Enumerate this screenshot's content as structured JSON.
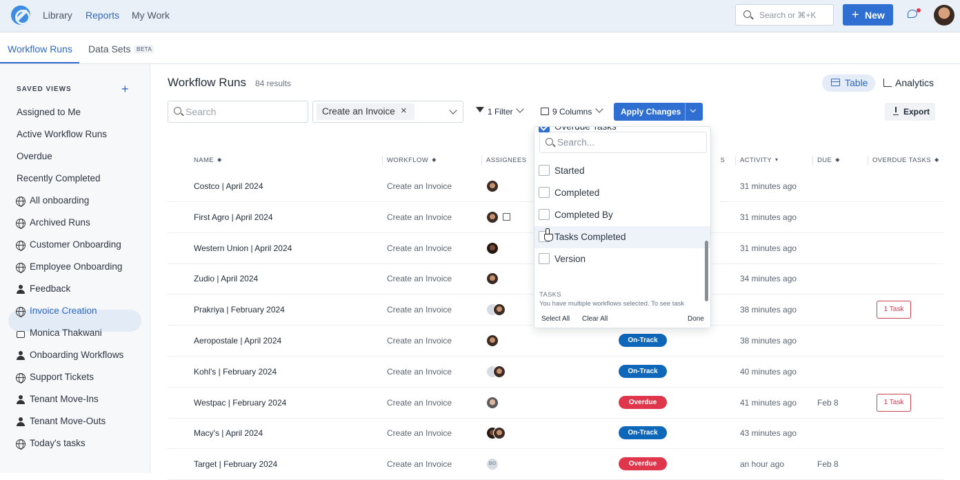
{
  "topnav": {
    "library": "Library",
    "reports": "Reports",
    "mywork": "My Work",
    "search_placeholder": "Search or ⌘+K",
    "new_label": "New"
  },
  "subtabs": {
    "workflow_runs": "Workflow Runs",
    "data_sets": "Data Sets",
    "beta": "BETA"
  },
  "sidebar": {
    "title": "SAVED VIEWS",
    "items": [
      {
        "label": "Assigned to Me",
        "icon": ""
      },
      {
        "label": "Active Workflow Runs",
        "icon": ""
      },
      {
        "label": "Overdue",
        "icon": ""
      },
      {
        "label": "Recently Completed",
        "icon": ""
      },
      {
        "label": "All onboarding",
        "icon": "globe-icon"
      },
      {
        "label": "Archived Runs",
        "icon": "globe-icon"
      },
      {
        "label": "Customer Onboarding",
        "icon": "globe-icon"
      },
      {
        "label": "Employee Onboarding",
        "icon": "globe-icon"
      },
      {
        "label": "Feedback",
        "icon": "people-icon"
      },
      {
        "label": "Invoice Creation",
        "icon": "globe-icon",
        "selected": true
      },
      {
        "label": "Monica Thakwani",
        "icon": "lock-icon"
      },
      {
        "label": "Onboarding Workflows",
        "icon": "people-icon"
      },
      {
        "label": "Support Tickets",
        "icon": "globe-icon"
      },
      {
        "label": "Tenant Move-Ins",
        "icon": "people-icon"
      },
      {
        "label": "Tenant Move-Outs",
        "icon": "people-icon"
      },
      {
        "label": "Today's tasks",
        "icon": "globe-icon"
      }
    ]
  },
  "main": {
    "title": "Workflow Runs",
    "results": "84 results",
    "view_table": "Table",
    "view_analytics": "Analytics",
    "search_placeholder": "Search",
    "workflow_chip": "Create an Invoice",
    "filter_label": "1 Filter",
    "columns_label": "9 Columns",
    "apply_label": "Apply Changes",
    "export_label": "Export"
  },
  "table": {
    "headers": {
      "name": "NAME",
      "workflow": "WORKFLOW",
      "assignees": "ASSIGNEES",
      "comments": "NTS",
      "activity": "ACTIVITY",
      "due": "DUE",
      "overdue_tasks": "OVERDUE TASKS"
    },
    "rows": [
      {
        "name": "Costco | April 2024",
        "workflow": "Create an Invoice",
        "status": "",
        "activity": "31 minutes ago",
        "due": "",
        "overdue": ""
      },
      {
        "name": "First Agro | April 2024",
        "workflow": "Create an Invoice",
        "status": "",
        "activity": "31 minutes ago",
        "due": "",
        "overdue": ""
      },
      {
        "name": "Western Union | April 2024",
        "workflow": "Create an Invoice",
        "status": "",
        "activity": "31 minutes ago",
        "due": "",
        "overdue": ""
      },
      {
        "name": "Zudio | April 2024",
        "workflow": "Create an Invoice",
        "status": "",
        "activity": "34 minutes ago",
        "due": "",
        "overdue": ""
      },
      {
        "name": "Prakriya | February 2024",
        "workflow": "Create an Invoice",
        "status": "",
        "activity": "38 minutes ago",
        "due": "",
        "overdue": "1 Task"
      },
      {
        "name": "Aeropostale | April 2024",
        "workflow": "Create an Invoice",
        "status": "On-Track",
        "activity": "38 minutes ago",
        "due": "",
        "overdue": ""
      },
      {
        "name": "Kohl's | February 2024",
        "workflow": "Create an Invoice",
        "status": "On-Track",
        "activity": "40 minutes ago",
        "due": "",
        "overdue": ""
      },
      {
        "name": "Westpac | February 2024",
        "workflow": "Create an Invoice",
        "status": "Overdue",
        "activity": "41 minutes ago",
        "due": "Feb 8",
        "overdue": "1 Task"
      },
      {
        "name": "Macy's | April 2024",
        "workflow": "Create an Invoice",
        "status": "On-Track",
        "activity": "43 minutes ago",
        "due": "",
        "overdue": ""
      },
      {
        "name": "Target | February 2024",
        "workflow": "Create an Invoice",
        "status": "Overdue",
        "activity": "an hour ago",
        "due": "Feb 8",
        "overdue": ""
      }
    ],
    "avatar_initials": "BO"
  },
  "columns_dropdown": {
    "search_placeholder": "Search...",
    "options": [
      {
        "label": "Overdue Tasks",
        "checked": true
      },
      {
        "label": "Started",
        "checked": false
      },
      {
        "label": "Completed",
        "checked": false
      },
      {
        "label": "Completed By",
        "checked": false
      },
      {
        "label": "Tasks Completed",
        "checked": false
      },
      {
        "label": "Version",
        "checked": false
      }
    ],
    "section": "TASKS",
    "note": "You have multiple workflows selected. To see task",
    "select_all": "Select All",
    "clear_all": "Clear All",
    "done": "Done"
  }
}
